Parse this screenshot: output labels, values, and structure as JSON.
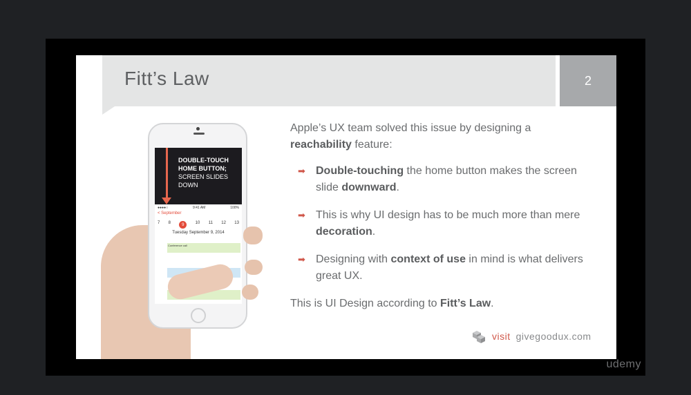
{
  "slide": {
    "title": "Fitt’s Law",
    "page_number": "2",
    "intro_pre": "Apple’s UX team solved this issue by designing a ",
    "intro_bold": "reachability",
    "intro_post": " feature:",
    "bullets": [
      {
        "pre": "",
        "bold1": "Double-touching",
        "mid": " the home button makes the screen slide ",
        "bold2": "downward",
        "post": "."
      },
      {
        "pre": "This is why UI design has to be much more than mere ",
        "bold1": "decoration",
        "mid": ".",
        "bold2": "",
        "post": ""
      },
      {
        "pre": "Designing with ",
        "bold1": "context of use",
        "mid": " in mind is what delivers great UX.",
        "bold2": "",
        "post": ""
      }
    ],
    "conclusion_pre": "This is UI Design according to ",
    "conclusion_bold": "Fitt’s Law",
    "conclusion_post": ".",
    "footer_visit": "visit",
    "footer_site": "givegoodux.com"
  },
  "phone": {
    "caption_bold": "DOUBLE-TOUCH HOME BUTTON;",
    "caption_rest": "SCREEN SLIDES DOWN",
    "status_left": "●●●●○",
    "status_time": "9:41 AM",
    "status_right": "100%",
    "nav_label": "< September",
    "days": [
      "7",
      "8",
      "9",
      "10",
      "11",
      "12",
      "13"
    ],
    "today": "9",
    "date_line": "Tuesday  September 9, 2014",
    "event_label": "Conference call"
  },
  "watermark": "udemy",
  "colors": {
    "accent": "#d0574a",
    "title_band": "#e4e5e5",
    "page_box": "#a7a9ab"
  },
  "icons": {
    "bullet": "arrow-right-icon",
    "logo": "cube-logo-icon"
  }
}
